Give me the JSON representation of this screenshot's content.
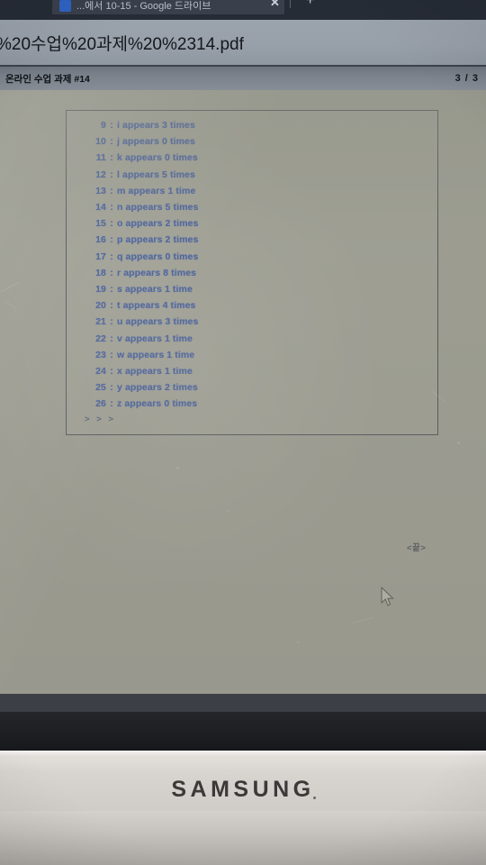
{
  "browser": {
    "tab_title": "...에서 10-15 - Google 드라이브",
    "close_icon": "close-icon",
    "newtab_icon": "plus-icon",
    "newtab_label": "+",
    "close_label": "✕"
  },
  "pdf_viewer": {
    "filename": "%20수업%20과제%20%2314.pdf",
    "doc_name": "온라인 수업 과제 #14",
    "page_current": 3,
    "page_total": 3,
    "page_count_label": "3 / 3"
  },
  "console": {
    "prompt": "> > >",
    "rows": [
      {
        "index": "9",
        "colon": ":",
        "text": "i appears 3 times"
      },
      {
        "index": "10",
        "colon": ":",
        "text": "j appears 0 times"
      },
      {
        "index": "11",
        "colon": ":",
        "text": "k appears 0 times"
      },
      {
        "index": "12",
        "colon": ":",
        "text": "l appears 5 times"
      },
      {
        "index": "13",
        "colon": ":",
        "text": "m appears 1 time"
      },
      {
        "index": "14",
        "colon": ":",
        "text": "n appears 5 times"
      },
      {
        "index": "15",
        "colon": ":",
        "text": "o appears 2 times"
      },
      {
        "index": "16",
        "colon": ":",
        "text": "p appears 2 times"
      },
      {
        "index": "17",
        "colon": ":",
        "text": "q appears 0 times"
      },
      {
        "index": "18",
        "colon": ":",
        "text": "r appears 8 times"
      },
      {
        "index": "19",
        "colon": ":",
        "text": "s appears 1 time"
      },
      {
        "index": "20",
        "colon": ":",
        "text": "t appears 4 times"
      },
      {
        "index": "21",
        "colon": ":",
        "text": "u appears 3 times"
      },
      {
        "index": "22",
        "colon": ":",
        "text": "v appears 1 time"
      },
      {
        "index": "23",
        "colon": ":",
        "text": "w appears 1 time"
      },
      {
        "index": "24",
        "colon": ":",
        "text": "x appears 1 time"
      },
      {
        "index": "25",
        "colon": ":",
        "text": "y appears 2 times"
      },
      {
        "index": "26",
        "colon": ":",
        "text": "z appears 0 times"
      }
    ]
  },
  "annotations": {
    "end_marker": "<끝>"
  },
  "hardware": {
    "brand": "SAMSUNG"
  },
  "colors": {
    "console_text": "#28489c",
    "page_background": "#9a9a8f",
    "titlebar": "#98a0aa",
    "toolbar": "#7b828c",
    "bezel": "#d8d4d0"
  }
}
